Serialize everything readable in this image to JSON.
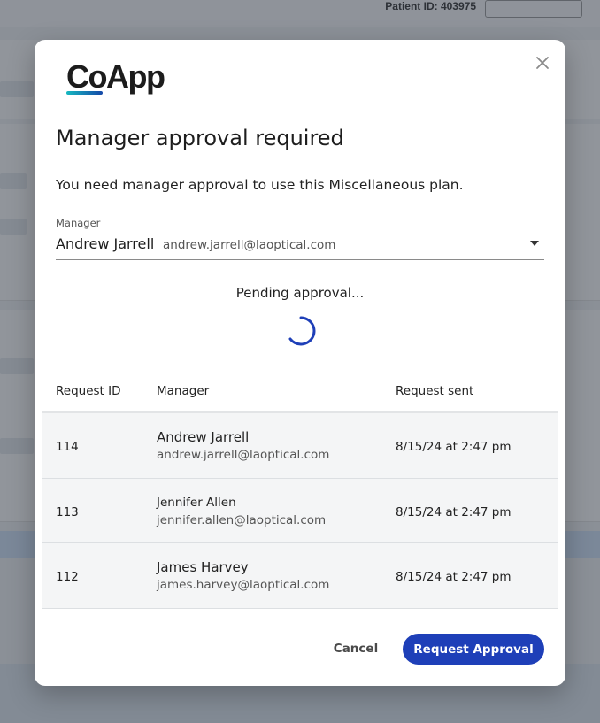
{
  "background": {
    "patient_id_text": "Patient ID: 403975"
  },
  "dialog": {
    "logo_text": "CoApp",
    "title": "Manager approval required",
    "description": "You need manager approval to use this Miscellaneous plan.",
    "manager_field": {
      "label": "Manager",
      "selected_name": "Andrew Jarrell",
      "selected_email": "andrew.jarrell@laoptical.com"
    },
    "status_text": "Pending approval...",
    "table": {
      "headers": [
        "Request ID",
        "Manager",
        "Request sent"
      ],
      "rows": [
        {
          "id": "114",
          "manager_name": "Andrew Jarrell",
          "manager_email": "andrew.jarrell@laoptical.com",
          "sent": "8/15/24 at 2:47 pm"
        },
        {
          "id": "113",
          "manager_name": "Jennifer Allen",
          "manager_email": "jennifer.allen@laoptical.com",
          "sent": "8/15/24 at 2:47 pm"
        },
        {
          "id": "112",
          "manager_name": "James Harvey",
          "manager_email": "james.harvey@laoptical.com",
          "sent": "8/15/24 at 2:47 pm"
        }
      ]
    },
    "buttons": {
      "cancel": "Cancel",
      "request_approval": "Request Approval"
    }
  },
  "colors": {
    "primary": "#1e3fb8",
    "spinner": "#1e3fb8",
    "logo_gradient_start": "#16b8c0",
    "logo_gradient_end": "#1548a8"
  },
  "icons": {
    "close": "close-icon",
    "dropdown": "chevron-down-icon",
    "spinner": "loading-spinner-icon"
  }
}
